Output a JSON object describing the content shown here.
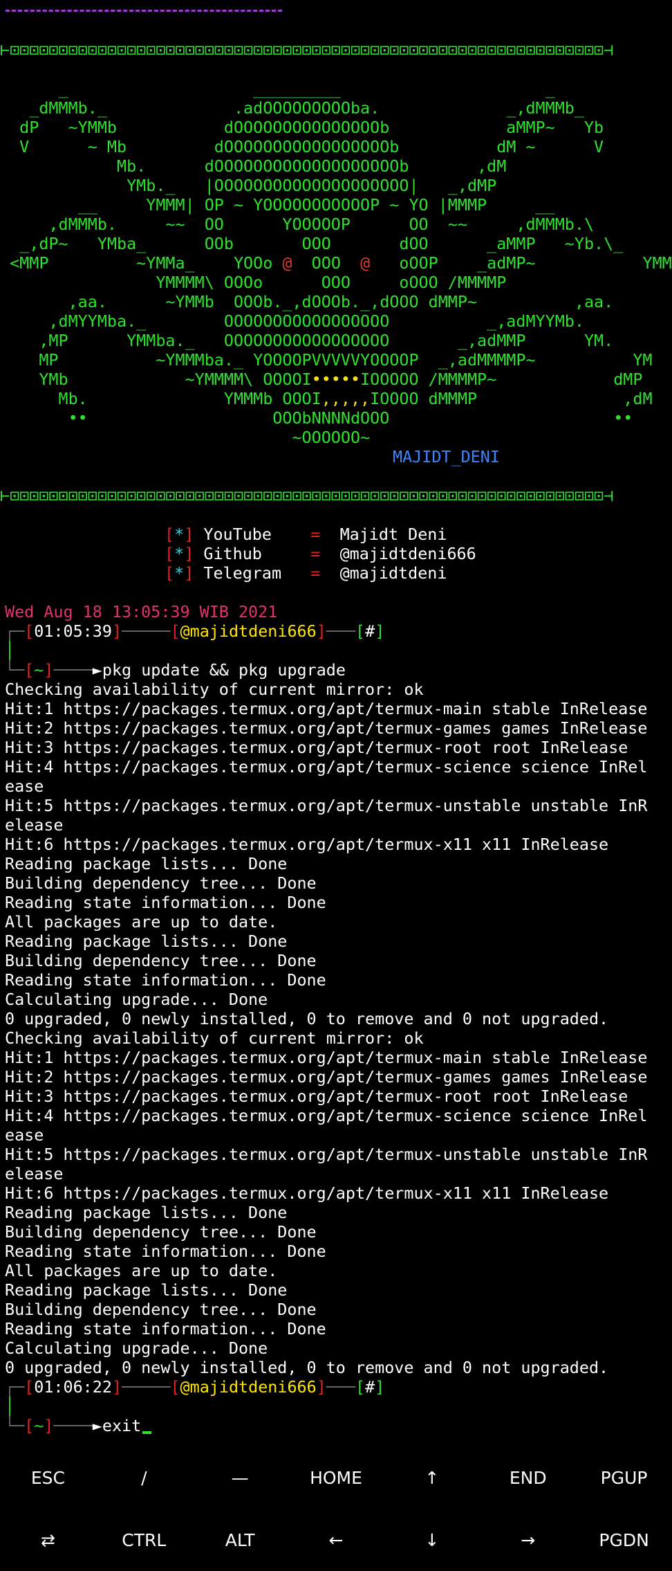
{
  "banner": {
    "line1": "      _                   _________                     _",
    "line2": "   _dMMMb._             .adOOOOOOOOOba.             _,dMMMb_",
    "line3": "  dP   ~YMMb           dOOOOOOOOOOOOOOOb            aMMP~   Yb",
    "line4": "  V      ~ Mb         dOOOOOOOOOOOOOOOOOb          dM ~      V",
    "line5": "            Mb.      dOOOOOOOOOOOOOOOOOOOb       ,dM",
    "line6": "             YMb._   |OOOOOOOOOOOOOOOOOOOO|   _,dMP",
    "line7": "        __     YMMM| OP ~ YOOOOOOOOOOOP ~ YO |MMMP     __",
    "line8": "     ,dMMMb.     ~~  OO      YOOOOOP      OO  ~~     ,dMMMb.\\",
    "line9": "  _,dP~   YMba_      OOb       OOO       dOO      _aMMP   ~Yb.\\_",
    "line10a": " <MMP         ~YMMa_    YOOo ",
    "line10b": "  OOO  ",
    "line10c": "   oOOP    _adMP~           YMM>",
    "line10_at": "@",
    "line11": "                YMMMM\\ OOOo      OOO     oOOO /MMMMP",
    "line12": "       ,aa.      ~YMMb  OOOb._,dOOOb._,dOOO dMMP~          ,aa.",
    "line13": "     ,dMYYMba._        OOOOOOOOOOOOOOOOO          _,adMYYMb.",
    "line14": "    ,MP      YMMba._   OOOOOOOOOOOOOOOOO       _,adMMP      YM.",
    "line15": "    MP          ~YMMMba._ YOOOOPVVVVVYOOOOP  _,adMMMMP~          YM",
    "line16": "    YMb            ~YMMMM\\ OOOOI",
    "line16_dots": "•••••",
    "line16b": "IOOOOO /MMMMP~            dMP",
    "line17": "      Mb.              YMMMb OOOI",
    "line17_commas": ",,,,,",
    "line17b": "IOOOO dMMMP               ,dM",
    "line18": "       ••                   OOObNNNNdOOO                       ••",
    "line19": "                              ~OOOOOO~",
    "author": "MAJIDT_DENI",
    "border": "⊢⊡⊡⊡⊡⊡⊡⊡⊡⊡⊡⊡⊡⊡⊡⊡⊡⊡⊡⊡⊡⊡⊡⊡⊡⊡⊡⊡⊡⊡⊡⊡⊡⊡⊡⊡⊡⊡⊡⊡⊡⊡⊡⊡⊡⊡⊡⊡⊡⊡⊡⊡⊡⊡⊡⊡⊡⊡⊡⊡⊡⊡⊣"
  },
  "contacts": [
    {
      "label": "YouTube ",
      "value": "Majidt Deni"
    },
    {
      "label": "Github  ",
      "value": "@majidtdeni666"
    },
    {
      "label": "Telegram",
      "value": "@majidtdeni"
    }
  ],
  "contact_bullet": "*",
  "contact_eq": "=",
  "date": "Wed Aug 18 13:05:39 WIB 2021",
  "prompt1": {
    "time": "01:05:39",
    "user": "@majidtdeni666",
    "hash": "#",
    "dir": "~",
    "command": "pkg update && pkg upgrade"
  },
  "prompt2": {
    "time": "01:06:22",
    "user": "@majidtdeni666",
    "hash": "#",
    "dir": "~",
    "command": "exit"
  },
  "output": [
    "Checking availability of current mirror: ok",
    "Hit:1 https://packages.termux.org/apt/termux-main stable InRelease",
    "Hit:2 https://packages.termux.org/apt/termux-games games InRelease",
    "Hit:3 https://packages.termux.org/apt/termux-root root InRelease",
    "Hit:4 https://packages.termux.org/apt/termux-science science InRel",
    "ease",
    "Hit:5 https://packages.termux.org/apt/termux-unstable unstable InR",
    "elease",
    "Hit:6 https://packages.termux.org/apt/termux-x11 x11 InRelease",
    "Reading package lists... Done",
    "Building dependency tree... Done",
    "Reading state information... Done",
    "All packages are up to date.",
    "Reading package lists... Done",
    "Building dependency tree... Done",
    "Reading state information... Done",
    "Calculating upgrade... Done",
    "0 upgraded, 0 newly installed, 0 to remove and 0 not upgraded.",
    "Checking availability of current mirror: ok",
    "Hit:1 https://packages.termux.org/apt/termux-main stable InRelease",
    "Hit:2 https://packages.termux.org/apt/termux-games games InRelease",
    "Hit:3 https://packages.termux.org/apt/termux-root root InRelease",
    "Hit:4 https://packages.termux.org/apt/termux-science science InRel",
    "ease",
    "Hit:5 https://packages.termux.org/apt/termux-unstable unstable InR",
    "elease",
    "Hit:6 https://packages.termux.org/apt/termux-x11 x11 InRelease",
    "Reading package lists... Done",
    "Building dependency tree... Done",
    "Reading state information... Done",
    "All packages are up to date.",
    "Reading package lists... Done",
    "Building dependency tree... Done",
    "Reading state information... Done",
    "Calculating upgrade... Done",
    "0 upgraded, 0 newly installed, 0 to remove and 0 not upgraded."
  ],
  "extra_keys": {
    "row1": [
      "ESC",
      "/",
      "—",
      "HOME",
      "↑",
      "END",
      "PGUP"
    ],
    "row2": [
      "⇄",
      "CTRL",
      "ALT",
      "←",
      "↓",
      "→",
      "PGDN"
    ]
  },
  "colors": {
    "background": "#000000",
    "banner_green": "#2fe02f",
    "prompt_red": "#e32222",
    "user_yellow": "#ffe600",
    "date_magenta": "#d83bd8",
    "author_blue": "#3b86ff"
  }
}
